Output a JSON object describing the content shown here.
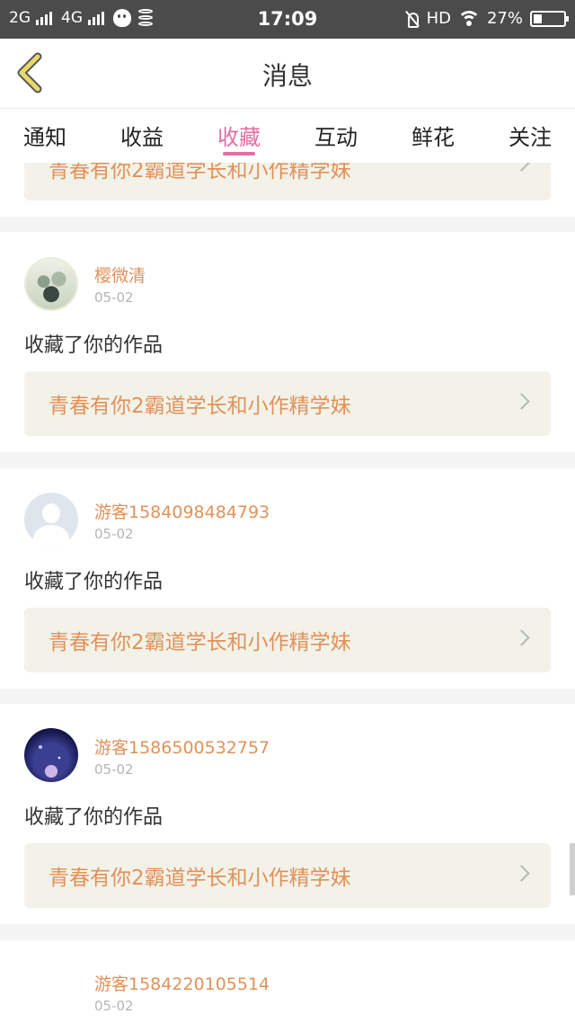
{
  "status_bar": {
    "network1": "2G",
    "network2": "4G",
    "time": "17:09",
    "hd": "HD",
    "battery": "27%",
    "battery_level": 0.27,
    "icons": [
      "signal-icon",
      "qq-icon",
      "database-icon",
      "mute-icon",
      "wifi-icon",
      "battery-icon"
    ]
  },
  "header": {
    "title": "消息"
  },
  "tabs": [
    {
      "label": "通知",
      "active": false
    },
    {
      "label": "收益",
      "active": false
    },
    {
      "label": "收藏",
      "active": true
    },
    {
      "label": "互动",
      "active": false
    },
    {
      "label": "鲜花",
      "active": false
    },
    {
      "label": "关注",
      "active": false
    }
  ],
  "colors": {
    "accent_pink": "#e46ea3",
    "orange_text": "#e0925a",
    "back_arrow": "#e8d96a"
  },
  "feed": {
    "partial_top_work": "青春有你2霸道学长和小作精学妹",
    "items": [
      {
        "user": "樱微清",
        "date": "05-02",
        "action": "收藏了你的作品",
        "work": "青春有你2霸道学长和小作精学妹"
      },
      {
        "user": "游客1584098484793",
        "date": "05-02",
        "action": "收藏了你的作品",
        "work": "青春有你2霸道学长和小作精学妹"
      },
      {
        "user": "游客1586500532757",
        "date": "05-02",
        "action": "收藏了你的作品",
        "work": "青春有你2霸道学长和小作精学妹"
      },
      {
        "user": "游客1584220105514",
        "date": "05-02"
      }
    ]
  }
}
